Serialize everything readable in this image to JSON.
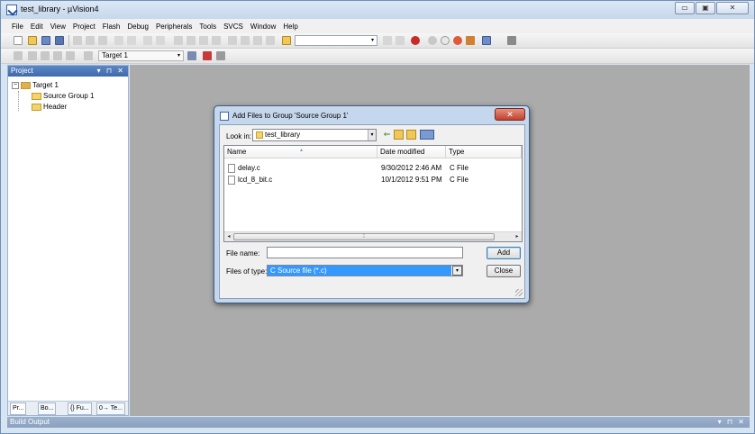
{
  "window": {
    "title": "test_library  - µVision4",
    "minimize": "▭",
    "maximize": "▣",
    "close": "✕"
  },
  "menubar": [
    "File",
    "Edit",
    "View",
    "Project",
    "Flash",
    "Debug",
    "Peripherals",
    "Tools",
    "SVCS",
    "Window",
    "Help"
  ],
  "toolbar2": {
    "target": "Target 1"
  },
  "project_panel": {
    "title": "Project",
    "controls": "▾ ⊓ ✕",
    "tree": {
      "root": "Target 1",
      "group": "Source Group 1",
      "child": "Header"
    },
    "tabs": [
      "Pr...",
      "Bo...",
      "{} Fu...",
      "0→ Te..."
    ]
  },
  "build_output": {
    "title": "Build Output",
    "controls": "▾ ⊓ ✕"
  },
  "dialog": {
    "title": "Add Files to Group 'Source Group 1'",
    "close": "✕",
    "look_in_label": "Look in:",
    "look_in_value": "test_library",
    "columns": [
      "Name",
      "Date modified",
      "Type"
    ],
    "files": [
      {
        "name": "delay.c",
        "date": "9/30/2012 2:46 AM",
        "type": "C File"
      },
      {
        "name": "lcd_8_bit.c",
        "date": "10/1/2012 9:51 PM",
        "type": "C File"
      }
    ],
    "file_name_label": "File name:",
    "file_name_value": "",
    "file_type_label": "Files of type:",
    "file_type_value": "C Source file (*.c)",
    "add_label": "Add",
    "close_label": "Close"
  }
}
